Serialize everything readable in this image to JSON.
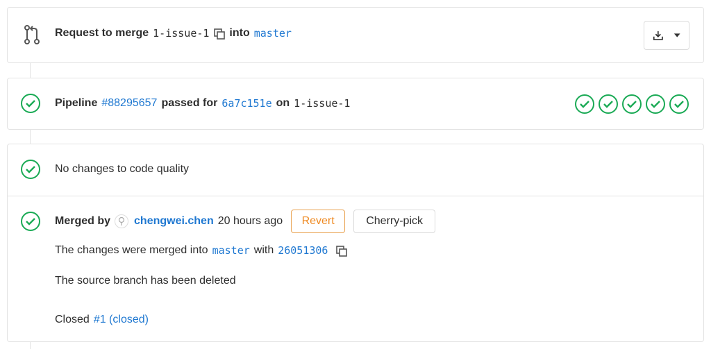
{
  "merge_request": {
    "label": "Request to merge",
    "source_branch": "1-issue-1",
    "into_label": "into",
    "target_branch": "master"
  },
  "pipeline": {
    "label": "Pipeline",
    "id": "#88295657",
    "passed_for": "passed for",
    "commit": "6a7c151e",
    "on_label": "on",
    "branch": "1-issue-1",
    "stages": [
      "passed",
      "passed",
      "passed",
      "passed",
      "passed"
    ]
  },
  "code_quality": {
    "message": "No changes to code quality"
  },
  "merged": {
    "label": "Merged by",
    "user": "chengwei.chen",
    "time": "20 hours ago",
    "revert_label": "Revert",
    "cherry_pick_label": "Cherry-pick",
    "changes_text": "The changes were merged into",
    "target_branch": "master",
    "with_label": "with",
    "merge_commit": "26051306",
    "source_deleted": "The source branch has been deleted",
    "closed_label": "Closed",
    "closed_issue": "#1 (closed)"
  },
  "colors": {
    "success": "#1aaa55",
    "link": "#1f78d1",
    "warning": "#ef8b24",
    "border": "#e3e3e3"
  }
}
